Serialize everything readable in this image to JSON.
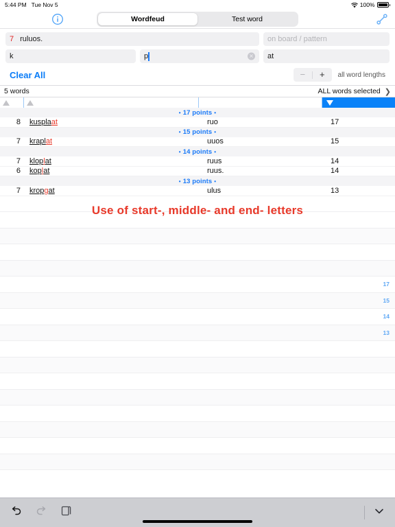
{
  "status_bar": {
    "time": "5:44 PM",
    "date": "Tue Nov 5",
    "battery_percent": "100%",
    "wifi_icon": "wifi-icon",
    "battery_icon": "battery-full-icon"
  },
  "nav_bar": {
    "info_icon": "info-circle-icon",
    "tools_icon": "wrench-icon",
    "tabs": [
      {
        "label": "Wordfeud",
        "active": true
      },
      {
        "label": "Test word",
        "active": false
      }
    ]
  },
  "inputs": {
    "rack": {
      "count": "7",
      "value": "ruluos."
    },
    "pattern": {
      "value": "",
      "placeholder": "on board / pattern"
    },
    "start_letters": {
      "value": "k",
      "placeholder": ""
    },
    "middle_letters": {
      "value": "p",
      "placeholder": "",
      "has_caret": true,
      "clear_icon": "clear-circle-icon"
    },
    "end_letters": {
      "value": "at",
      "placeholder": ""
    },
    "clear_all_label": "Clear All",
    "stepper": {
      "minus": "−",
      "plus": "+",
      "minus_disabled": true
    },
    "length_label": "all word lengths"
  },
  "results_header": {
    "word_count_label": "5 words",
    "selection_label": "ALL words selected",
    "chevron_icon": "chevron-right-icon"
  },
  "sort_bar": {
    "columns": [
      {
        "name": "length",
        "icon": "sort-ascending-icon",
        "active": false
      },
      {
        "name": "word",
        "icon": "sort-ascending-icon",
        "active": false
      },
      {
        "name": "remaining",
        "icon": "",
        "active": false
      },
      {
        "name": "points",
        "icon": "sort-descending-icon",
        "active": true
      }
    ],
    "active_color": "#0a82f8"
  },
  "results": [
    {
      "group_label": "17 points",
      "rows": [
        {
          "length": "8",
          "word_plain": "kuspla",
          "word_red": "at",
          "rest": "ruo",
          "points": "17",
          "alt": false
        }
      ]
    },
    {
      "group_label": "15 points",
      "rows": [
        {
          "length": "7",
          "word_plain": "krapl",
          "word_red": "at",
          "rest": "uuos",
          "points": "15",
          "alt": false
        }
      ]
    },
    {
      "group_label": "14 points",
      "rows": [
        {
          "length": "7",
          "word_plain_pre": "klop",
          "word_red": "l",
          "word_plain_post": "at",
          "rest": "ruus",
          "points": "14",
          "alt": false
        },
        {
          "length": "6",
          "word_plain_pre": "kop",
          "word_red": "l",
          "word_plain_post": "at",
          "rest": "ruus.",
          "points": "14",
          "alt": false
        }
      ]
    },
    {
      "group_label": "13 points",
      "rows": [
        {
          "length": "7",
          "word_plain_pre": "krop",
          "word_red": "g",
          "word_plain_post": "at",
          "rest": "ulus",
          "points": "13",
          "alt": false
        }
      ]
    }
  ],
  "annotation": {
    "note": "Use of start-,  middle- and  end- letters",
    "note_color": "#e8392a"
  },
  "ruled_numbers": [
    "17",
    "15",
    "14",
    "13"
  ],
  "bottom_bar": {
    "undo_icon": "undo-icon",
    "redo_icon": "redo-icon",
    "paste_icon": "clipboard-icon",
    "collapse_icon": "chevron-down-icon",
    "redo_disabled": true
  }
}
